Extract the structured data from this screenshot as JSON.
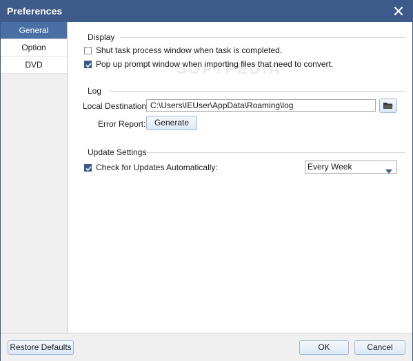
{
  "window": {
    "title": "Preferences"
  },
  "sidebar": {
    "items": [
      {
        "label": "General",
        "active": true
      },
      {
        "label": "Option",
        "active": false
      },
      {
        "label": "DVD",
        "active": false
      }
    ]
  },
  "display": {
    "title": "Display",
    "shut_task": {
      "label": "Shut task process window when task is completed.",
      "checked": false
    },
    "popup_prompt": {
      "label": "Pop up prompt window when importing files that need to convert.",
      "checked": true
    }
  },
  "log": {
    "title": "Log",
    "local_destination_label": "Local Destination:",
    "local_destination_value": "C:\\Users\\IEUser\\AppData\\Roaming\\log",
    "error_report_label": "Error Report:",
    "generate_label": "Generate"
  },
  "update": {
    "title": "Update Settings",
    "check_label": "Check for Updates Automatically:",
    "checked": true,
    "frequency": "Every Week"
  },
  "footer": {
    "restore_label": "Restore Defaults",
    "ok_label": "OK",
    "cancel_label": "Cancel"
  },
  "colors": {
    "titlebar": "#3d5a8a",
    "accent": "#4a6fa5",
    "checkbox": "#3b5a8c"
  },
  "watermark": "SOFTPEDIA"
}
